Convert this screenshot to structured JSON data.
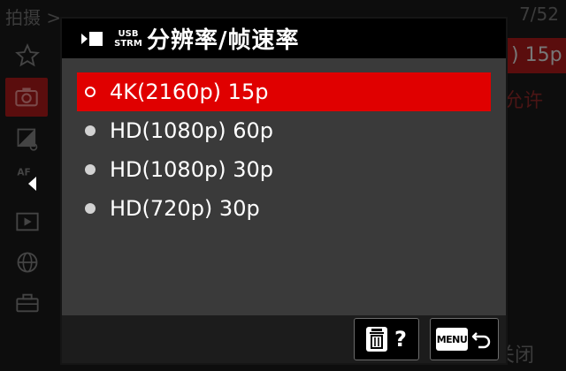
{
  "background": {
    "breadcrumb": "拍摄 > ",
    "page_indicator": "7/52",
    "right_tab_value": ") 15p",
    "right_text": "允许",
    "bottom_right_text": "关闭",
    "sidebar_icons": [
      "star-icon",
      "camera-icon",
      "exposure-icon",
      "af-icon",
      "play-icon",
      "globe-icon",
      "toolbox-icon"
    ]
  },
  "dialog": {
    "header": {
      "movie_icon": "movie-icon",
      "usb_icon_line1": "USB",
      "usb_icon_line2": "STRM",
      "title": "分辨率/帧速率"
    },
    "options": [
      {
        "label": "4K(2160p) 15p",
        "selected": true
      },
      {
        "label": "HD(1080p) 60p",
        "selected": false
      },
      {
        "label": "HD(1080p) 30p",
        "selected": false
      },
      {
        "label": "HD(720p) 30p",
        "selected": false
      }
    ],
    "footer": {
      "delete_icon": "trash-icon",
      "help_label": "?",
      "menu_label": "MENU",
      "return_icon": "return-arrow-icon"
    }
  },
  "colors": {
    "selection": "#e00000",
    "dialog_bg": "#3a3a3a",
    "header_bg": "#000000",
    "active_tab_bg": "#5a0d0d"
  }
}
